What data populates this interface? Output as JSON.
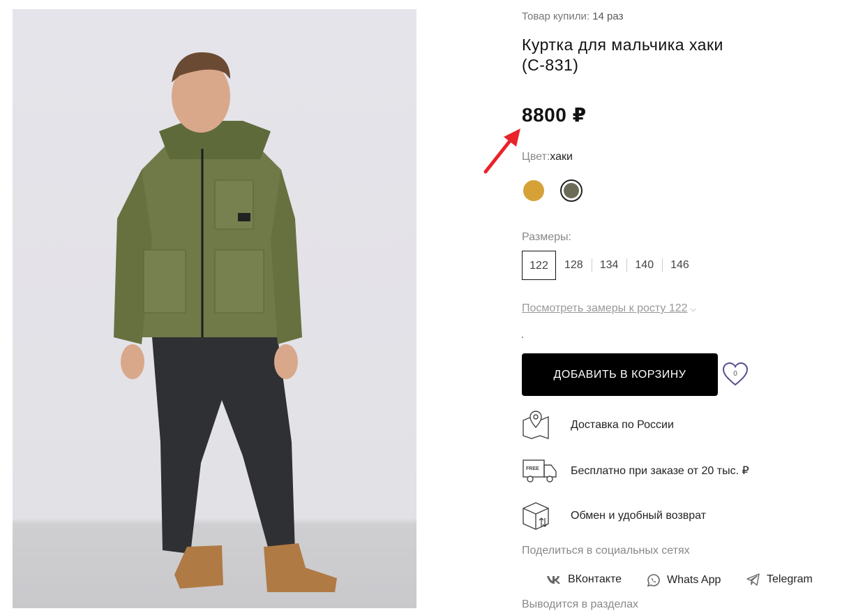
{
  "product": {
    "bought_label": "Товар купили:",
    "bought_count": "14 раз",
    "title": "Куртка для мальчика хаки (С-831)",
    "price": "8800 ₽"
  },
  "color": {
    "label": "Цвет:",
    "value": "хаки",
    "swatches": [
      "#d6a237",
      "#6b6b58"
    ]
  },
  "sizes": {
    "label": "Размеры:",
    "options": [
      "122",
      "128",
      "134",
      "140",
      "146"
    ],
    "selected": "122"
  },
  "measure_link": "Посмотреть замеры к росту 122",
  "cart_button": "ДОБАВИТЬ В КОРЗИНУ",
  "wishlist_count": "0",
  "features": [
    {
      "icon": "map-pin-icon",
      "text": "Доставка по России"
    },
    {
      "icon": "free-truck-icon",
      "text": "Бесплатно при заказе от 20 тыс. ₽"
    },
    {
      "icon": "box-exchange-icon",
      "text": "Обмен и удобный возврат"
    }
  ],
  "share": {
    "label": "Поделиться в социальных сетях",
    "links": [
      {
        "icon": "vk-icon",
        "label": "ВКонтакте"
      },
      {
        "icon": "whatsapp-icon",
        "label": "Whats App"
      },
      {
        "icon": "telegram-icon",
        "label": "Telegram"
      }
    ]
  },
  "sections_label": "Выводится в разделах",
  "colors": {
    "accent_arrow": "#e8232a",
    "button": "#000000"
  }
}
